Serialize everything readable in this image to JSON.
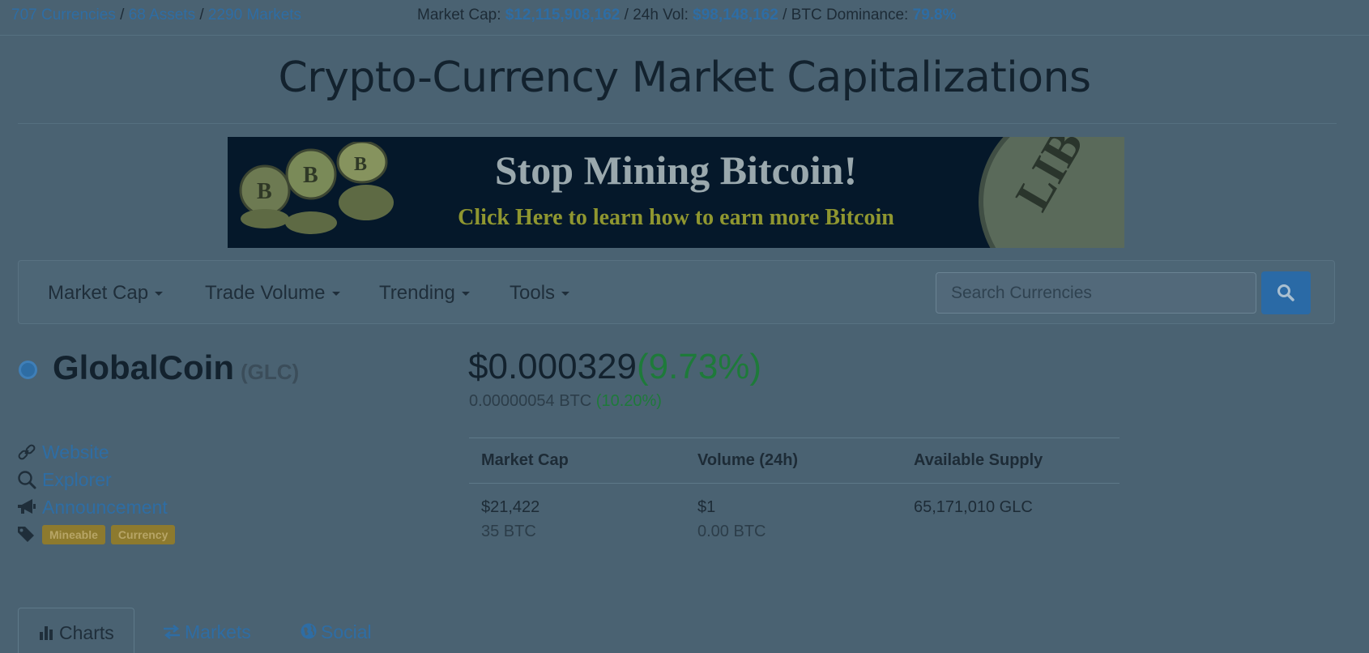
{
  "stats": {
    "currencies_link": "707 Currencies",
    "assets_link": "68 Assets",
    "markets_link": "2290 Markets",
    "sep": "/",
    "market_cap_label": "Market Cap:",
    "market_cap_value": "$12,115,908,162",
    "vol_label": "/ 24h Vol:",
    "vol_value": "$98,148,162",
    "dominance_label": "/ BTC Dominance:",
    "dominance_value": "79.8%"
  },
  "page_title": "Crypto-Currency Market Capitalizations",
  "banner": {
    "headline": "Stop Mining Bitcoin!",
    "subline": "Click Here to learn how to earn more Bitcoin"
  },
  "nav": {
    "items": [
      {
        "label": "Market Cap"
      },
      {
        "label": "Trade Volume"
      },
      {
        "label": "Trending"
      },
      {
        "label": "Tools"
      }
    ],
    "search_placeholder": "Search Currencies"
  },
  "coin": {
    "name": "GlobalCoin",
    "symbol": "(GLC)",
    "price_usd": "$0.000329",
    "price_change": "(9.73%)",
    "price_btc": "0.00000054 BTC",
    "btc_change": "(10.20%)"
  },
  "links": {
    "website": "Website",
    "explorer": "Explorer",
    "announcement": "Announcement",
    "tags": [
      "Mineable",
      "Currency"
    ]
  },
  "table": {
    "headers": [
      "Market Cap",
      "Volume (24h)",
      "Available Supply"
    ],
    "market_cap_usd": "$21,422",
    "market_cap_btc": "35 BTC",
    "volume_usd": "$1",
    "volume_btc": "0.00 BTC",
    "supply": "65,171,010 GLC"
  },
  "tabs": [
    {
      "label": "Charts"
    },
    {
      "label": "Markets"
    },
    {
      "label": "Social"
    }
  ],
  "colors": {
    "overlay_background": "#4a6272",
    "link": "#2e6da4",
    "positive": "#1e7a3a",
    "tag": "#8d7a2e",
    "search_button": "#2a6aa6"
  }
}
